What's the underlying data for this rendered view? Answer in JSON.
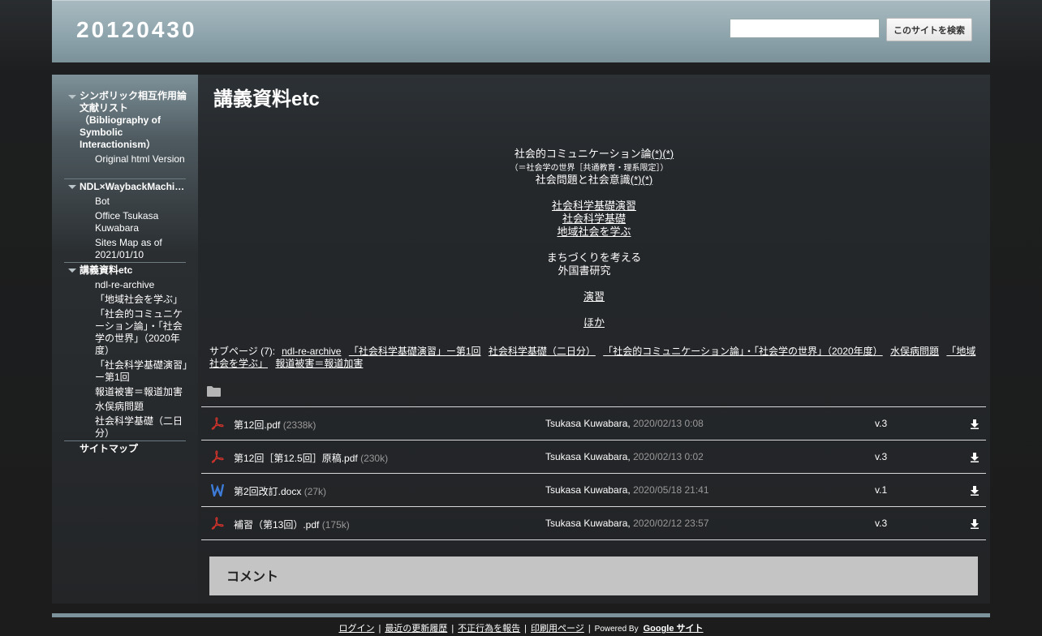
{
  "header": {
    "site_title": "20120430",
    "search_placeholder": "",
    "search_button": "このサイトを検索"
  },
  "sidebar": {
    "group1": {
      "title": "シンボリック相互作用論文献リスト（Bibliography of Symbolic Interactionism）",
      "items": [
        "Original html Version"
      ]
    },
    "group2": {
      "title": "NDL×WaybackMachi…",
      "items": [
        "Bot",
        "Office Tsukasa Kuwabara",
        "Sites Map as of 2021/01/10"
      ]
    },
    "group3": {
      "title": "講義資料etc",
      "items": [
        "ndl-re-archive",
        "「地域社会を学ぶ」",
        "「社会的コミュニケーション論」・「社会学の世界」（2020年度）",
        "「社会科学基礎演習」ー第1回",
        "報道被害＝報道加害",
        "水俣病問題",
        "社会科学基礎（二日分）"
      ]
    },
    "sitemap": "サイトマップ"
  },
  "main": {
    "page_title": "講義資料etc",
    "lines": {
      "l1_text": "社会的コミュニケーション論",
      "l1_link1": "(*)",
      "l1_link2": "(*)",
      "l2_text": "（＝社会学の世界［共通教育・理系限定］）",
      "l3_text": "社会問題と社会意識",
      "l3_link1": "(*)",
      "l3_link2": "(*)",
      "l4": "社会科学基礎演習",
      "l5": "社会科学基礎",
      "l6": "地域社会を学ぶ",
      "l7": "まちづくりを考える",
      "l8": "外国書研究",
      "l9": "演習",
      "l10": "ほか"
    },
    "subpages": {
      "label": "サブページ (7):",
      "links": [
        "ndl-re-archive",
        "「社会科学基礎演習」ー第1回",
        "社会科学基礎（二日分）",
        "「社会的コミュニケーション論」・「社会学の世界」（2020年度）",
        "水俣病問題",
        "「地域社会を学ぶ」",
        "報道被害＝報道加害"
      ]
    },
    "files": [
      {
        "icon": "pdf-icon",
        "name": "第12回.pdf",
        "size": "(2338k)",
        "author": "Tsukasa Kuwabara,",
        "date": "2020/02/13 0:08",
        "version": "v.3"
      },
      {
        "icon": "pdf-icon",
        "name": "第12回［第12.5回］原稿.pdf",
        "size": "(230k)",
        "author": "Tsukasa Kuwabara,",
        "date": "2020/02/13 0:02",
        "version": "v.3"
      },
      {
        "icon": "word-icon",
        "name": "第2回改訂.docx",
        "size": "(27k)",
        "author": "Tsukasa Kuwabara,",
        "date": "2020/05/18 21:41",
        "version": "v.1"
      },
      {
        "icon": "pdf-icon",
        "name": "補習（第13回）.pdf",
        "size": "(175k)",
        "author": "Tsukasa Kuwabara,",
        "date": "2020/02/12 23:57",
        "version": "v.3"
      }
    ],
    "comments_title": "コメント"
  },
  "footer": {
    "links": [
      "ログイン",
      "最近の更新履歴",
      "不正行為を報告",
      "印刷用ページ"
    ],
    "powered_by": "Powered By",
    "google_sites": "Google サイト"
  },
  "colors": {
    "header_bg": "#98adb4",
    "page_bg": "#1e1f20",
    "comments_bg": "#c4c4c4",
    "pdf_red": "#d0332b",
    "word_blue": "#3d7bd6"
  }
}
